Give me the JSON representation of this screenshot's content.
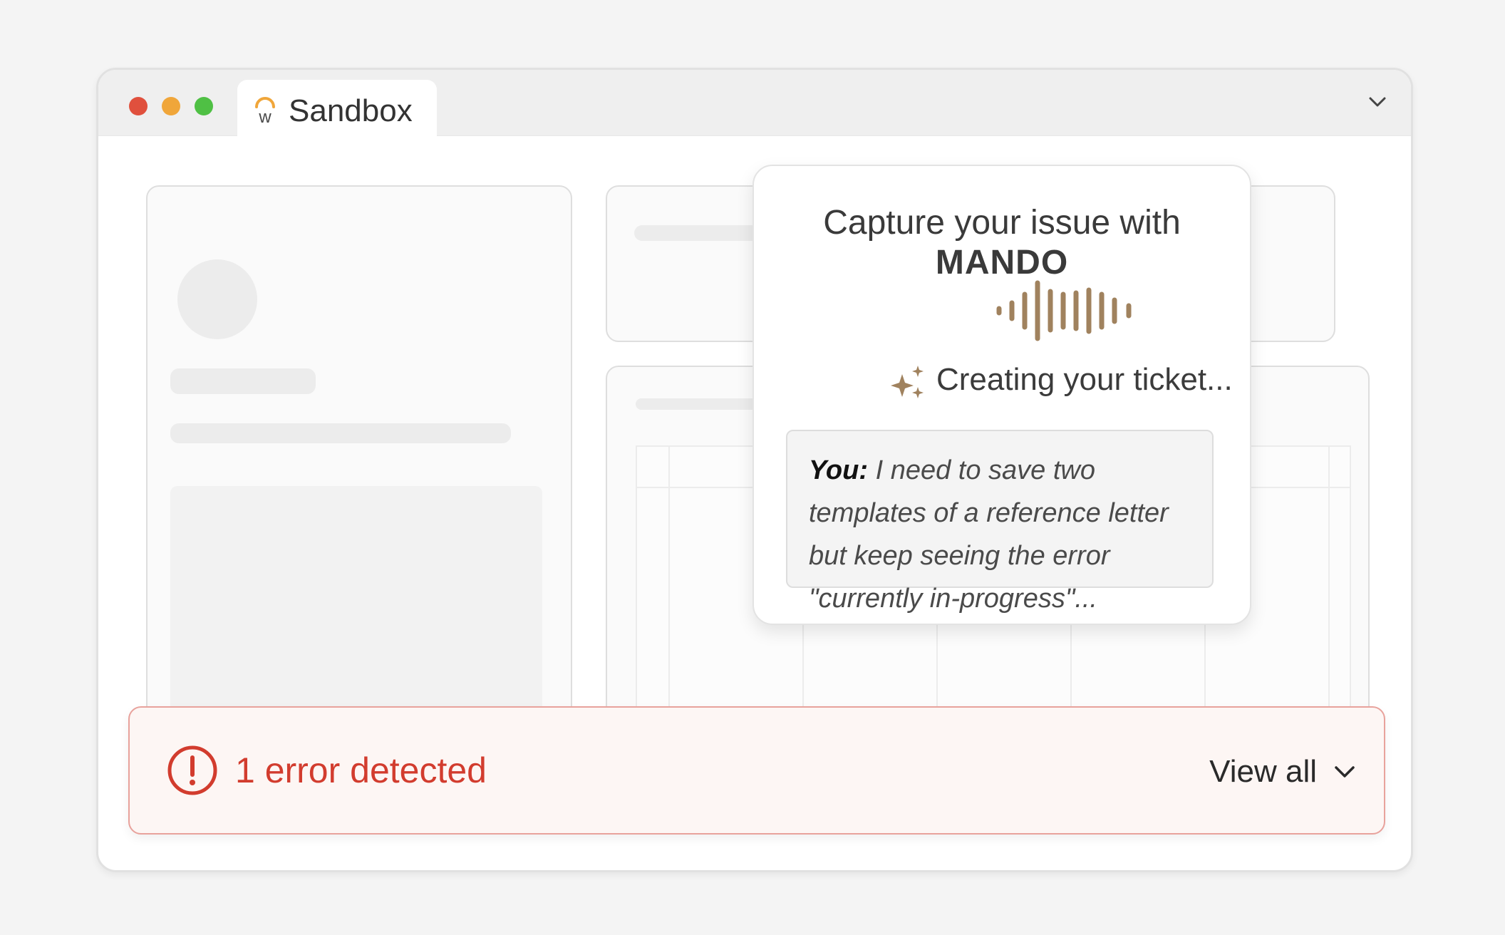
{
  "window": {
    "tab": {
      "title": "Sandbox",
      "logo_letter": "w"
    }
  },
  "popup": {
    "title_prefix": "Capture your issue with ",
    "title_brand": "MANDO",
    "status": "Creating your ticket...",
    "transcript": {
      "speaker": "You:",
      "text": " I need to save two templates of a reference letter but keep seeing the error \"currently in-progress\"..."
    }
  },
  "error_banner": {
    "message": "1 error detected",
    "action_label": "View all"
  },
  "colors": {
    "accent_brown": "#a0825e",
    "error_red": "#d23c2e"
  }
}
